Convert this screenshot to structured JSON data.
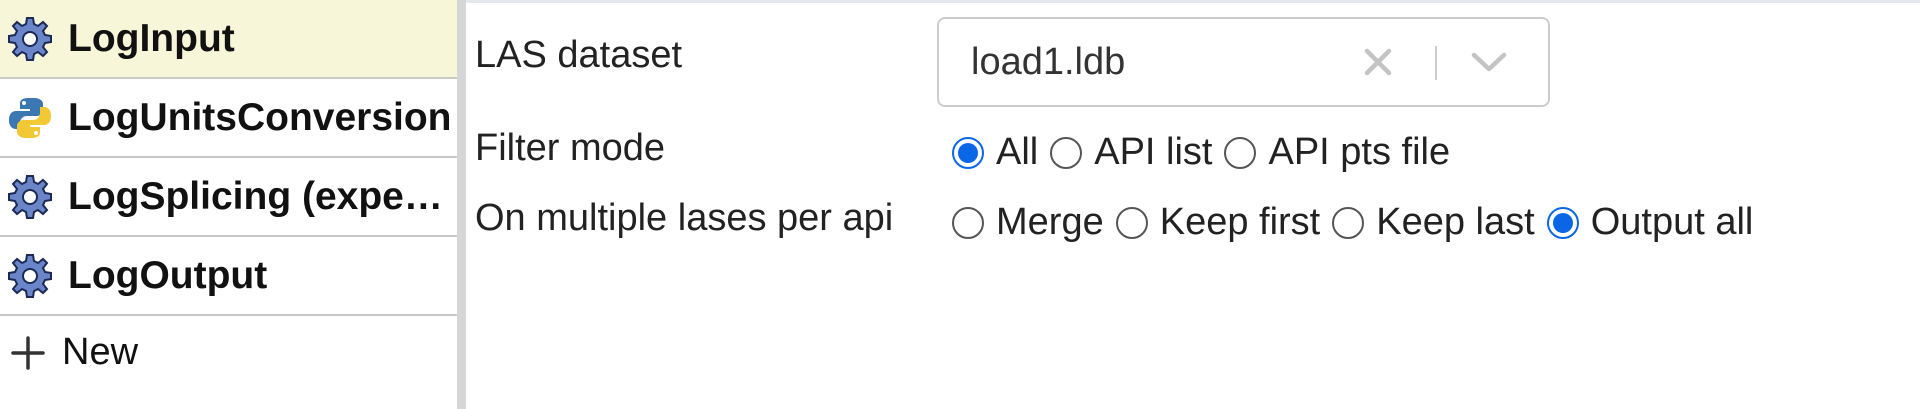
{
  "sidebar": {
    "nodes": [
      {
        "label": "LogInput",
        "icon": "gear-icon",
        "selected": true
      },
      {
        "label": "LogUnitsConversion",
        "icon": "python-icon",
        "selected": false
      },
      {
        "label": "LogSplicing (experimental)",
        "icon": "gear-icon",
        "selected": false
      },
      {
        "label": "LogOutput",
        "icon": "gear-icon",
        "selected": false
      }
    ],
    "new_label": "New",
    "new_icon": "plus-icon"
  },
  "form": {
    "las_dataset": {
      "label": "LAS dataset",
      "value": "load1.ldb",
      "clear_icon": "clear-x-icon",
      "dropdown_icon": "chevron-down-icon"
    },
    "filter_mode": {
      "label": "Filter mode",
      "options": [
        "All",
        "API list",
        "API pts file"
      ],
      "selected": "All"
    },
    "multiple_lases": {
      "label": "On multiple lases per api",
      "options": [
        "Merge",
        "Keep first",
        "Keep last",
        "Output all"
      ],
      "selected": "Output all"
    }
  },
  "colors": {
    "selected_node_bg": "#f8f6d8",
    "accent_blue": "#0a66e4",
    "splitter": "#d6d6d6"
  }
}
